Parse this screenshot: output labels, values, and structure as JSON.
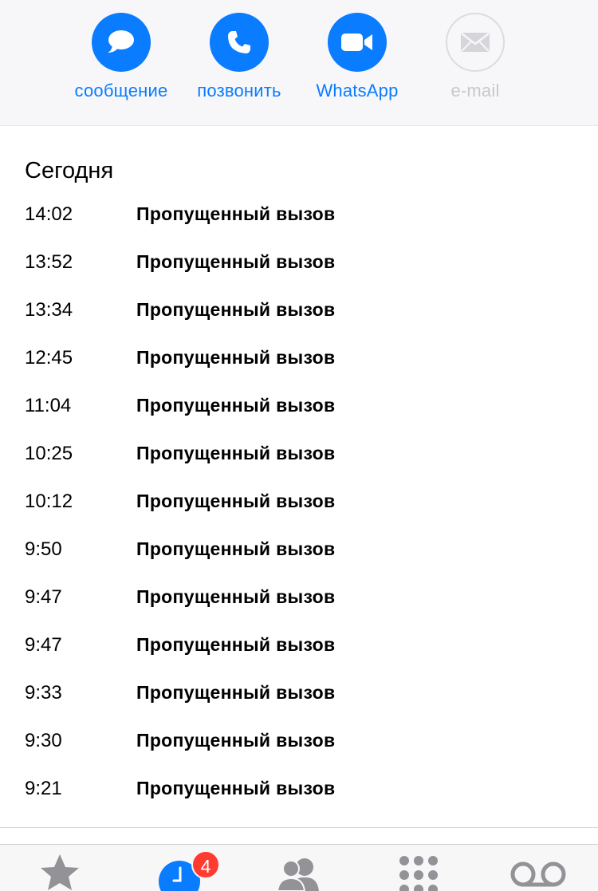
{
  "actions": {
    "message_label": "сообщение",
    "call_label": "позвонить",
    "whatsapp_label": "WhatsApp",
    "email_label": "e-mail",
    "accent_color": "#0a7cff",
    "disabled_color": "#c8c8cc"
  },
  "history": {
    "section_title": "Сегодня",
    "calls": [
      {
        "time": "14:02",
        "type": "Пропущенный вызов"
      },
      {
        "time": "13:52",
        "type": "Пропущенный вызов"
      },
      {
        "time": "13:34",
        "type": "Пропущенный вызов"
      },
      {
        "time": "12:45",
        "type": "Пропущенный вызов"
      },
      {
        "time": "11:04",
        "type": "Пропущенный вызов"
      },
      {
        "time": "10:25",
        "type": "Пропущенный вызов"
      },
      {
        "time": "10:12",
        "type": "Пропущенный вызов"
      },
      {
        "time": "9:50",
        "type": "Пропущенный вызов"
      },
      {
        "time": "9:47",
        "type": "Пропущенный вызов"
      },
      {
        "time": "9:47",
        "type": "Пропущенный вызов"
      },
      {
        "time": "9:33",
        "type": "Пропущенный вызов"
      },
      {
        "time": "9:30",
        "type": "Пропущенный вызов"
      },
      {
        "time": "9:21",
        "type": "Пропущенный вызов"
      }
    ]
  },
  "tabbar": {
    "recents_badge": "4",
    "icons": [
      "star-icon",
      "clock-icon",
      "contacts-icon",
      "keypad-icon",
      "voicemail-icon"
    ]
  }
}
